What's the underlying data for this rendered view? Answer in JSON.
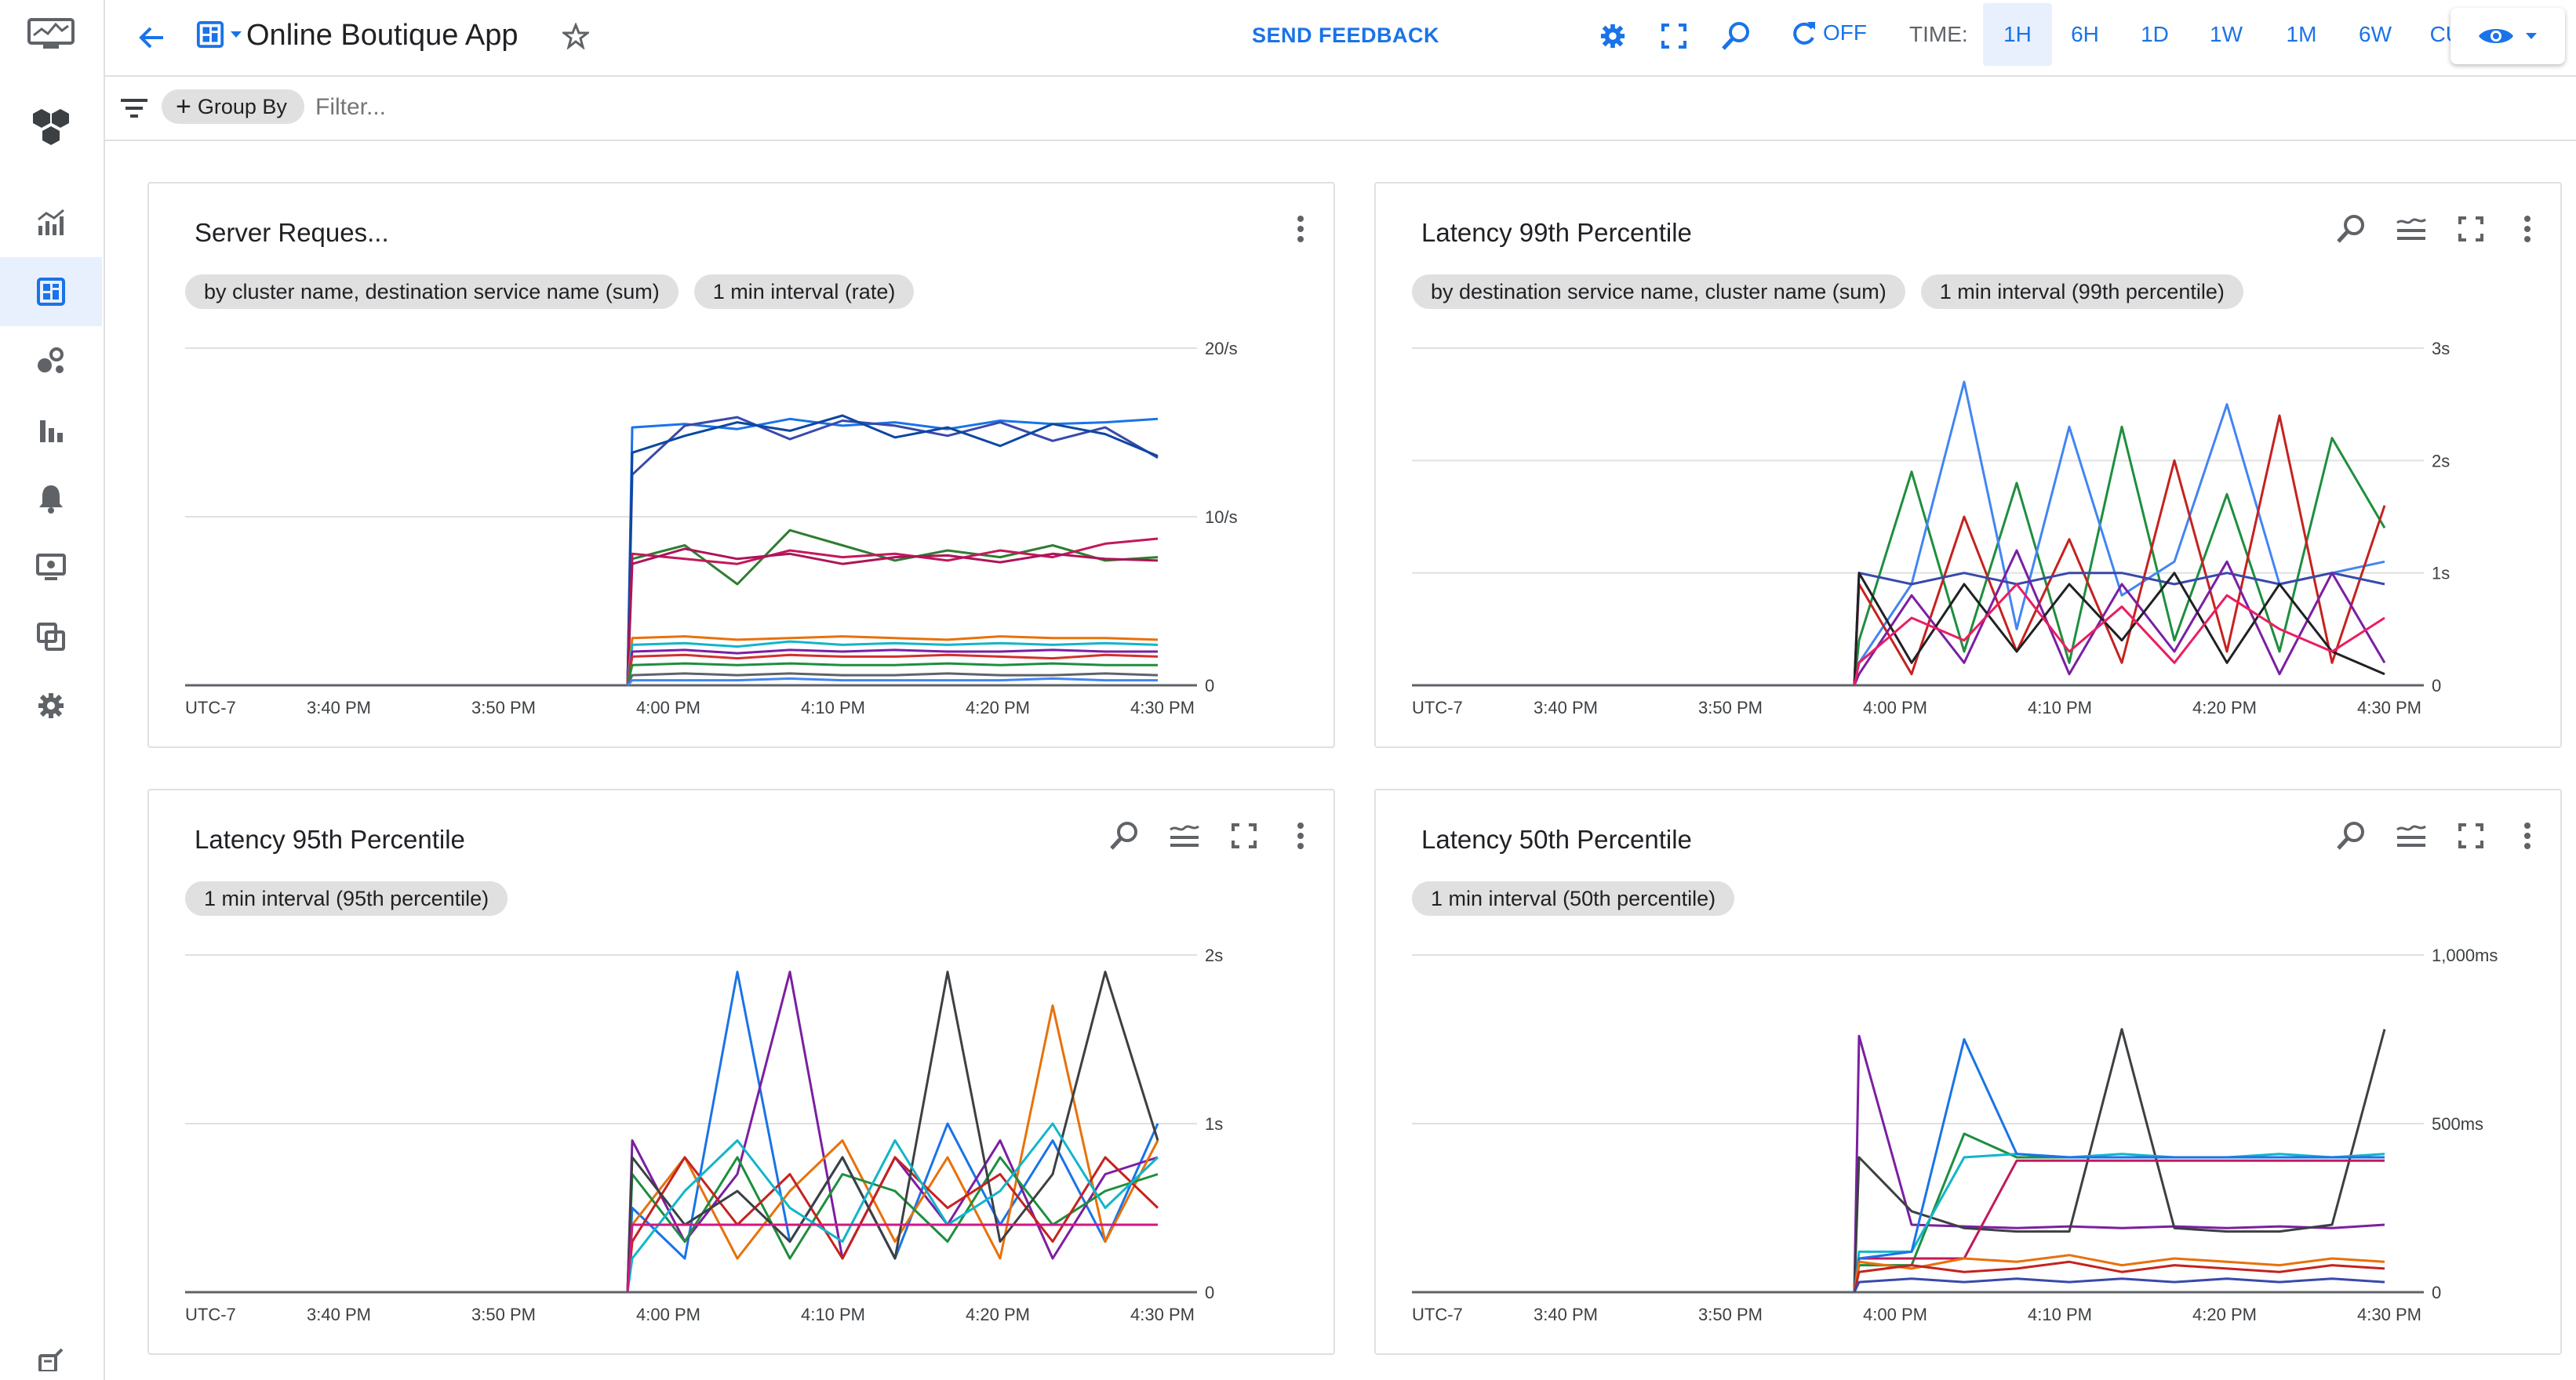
{
  "app": {
    "title": "Online Boutique App",
    "send_feedback": "SEND FEEDBACK",
    "auto_refresh": "OFF",
    "time_label": "TIME:",
    "time_options": [
      "1H",
      "6H",
      "1D",
      "1W",
      "1M",
      "6W",
      "CUSTOM"
    ],
    "time_selected": "1H",
    "accent": "#1a73e8"
  },
  "filterbar": {
    "group_by": "Group By",
    "filter_placeholder": "Filter..."
  },
  "sidebar": {
    "icons": [
      "monitoring-logo-icon",
      "hexagons-icon",
      "metrics-explorer-icon",
      "dashboards-icon",
      "services-icon",
      "bar-chart-icon",
      "alert-bell-icon",
      "uptime-monitor-icon",
      "groups-icon",
      "settings-icon",
      "release-notes-icon"
    ],
    "active": "dashboards-icon"
  },
  "panels": [
    {
      "title": "Server Reques...",
      "chips": [
        "by cluster name, destination service name (sum)",
        "1 min interval (rate)"
      ],
      "show_actions": false
    },
    {
      "title": "Latency 99th Percentile",
      "chips": [
        "by destination service name, cluster name (sum)",
        "1 min interval (99th percentile)"
      ],
      "show_actions": true
    },
    {
      "title": "Latency 95th Percentile",
      "chips": [
        "1 min interval (95th percentile)"
      ],
      "show_actions": true
    },
    {
      "title": "Latency 50th Percentile",
      "chips": [
        "1 min interval (50th percentile)"
      ],
      "show_actions": true
    }
  ],
  "chart_data": [
    {
      "type": "line",
      "title": "Server Reques...",
      "x_ticks": [
        "UTC-7",
        "3:40 PM",
        "3:50 PM",
        "4:00 PM",
        "4:10 PM",
        "4:20 PM",
        "4:30 PM"
      ],
      "y_ticks": [
        "0",
        "10/s",
        "20/s"
      ],
      "ylim": [
        0,
        20
      ],
      "grid": true,
      "series": [
        {
          "color": "#1a73e8",
          "values": [
            0,
            15.3,
            15.5,
            15.2,
            15.8,
            15.4,
            15.6,
            15.2,
            15.7,
            15.5,
            15.6,
            15.8
          ]
        },
        {
          "color": "#3949ab",
          "values": [
            0,
            12.5,
            15.4,
            15.9,
            14.6,
            15.7,
            15.4,
            14.8,
            15.6,
            14.5,
            15.3,
            13.5
          ]
        },
        {
          "color": "#0d47a1",
          "values": [
            0,
            13.8,
            14.8,
            15.6,
            15.1,
            16.0,
            14.7,
            15.3,
            14.2,
            15.5,
            14.9,
            13.6
          ]
        },
        {
          "color": "#2e7d32",
          "values": [
            0,
            7.5,
            8.3,
            6.0,
            9.2,
            8.3,
            7.4,
            8.0,
            7.6,
            8.3,
            7.4,
            7.6
          ]
        },
        {
          "color": "#c2185b",
          "values": [
            0,
            7.8,
            7.5,
            7.2,
            8.0,
            7.6,
            7.8,
            7.4,
            8.0,
            7.6,
            8.4,
            8.7
          ]
        },
        {
          "color": "#ad1457",
          "values": [
            0,
            7.2,
            8.1,
            7.5,
            7.8,
            7.2,
            7.6,
            7.7,
            7.3,
            7.8,
            7.5,
            7.4
          ]
        },
        {
          "color": "#e8710a",
          "values": [
            0,
            2.8,
            2.9,
            2.7,
            2.8,
            2.9,
            2.8,
            2.7,
            2.9,
            2.8,
            2.8,
            2.7
          ]
        },
        {
          "color": "#12b5cb",
          "values": [
            0,
            2.4,
            2.5,
            2.3,
            2.6,
            2.4,
            2.5,
            2.4,
            2.5,
            2.4,
            2.5,
            2.4
          ]
        },
        {
          "color": "#7b1fa2",
          "values": [
            0,
            2.0,
            2.1,
            1.9,
            2.1,
            2.0,
            2.1,
            2.0,
            2.0,
            2.1,
            2.0,
            2.0
          ]
        },
        {
          "color": "#d32f2f",
          "values": [
            0,
            1.7,
            1.8,
            1.6,
            1.8,
            1.7,
            1.7,
            1.8,
            1.7,
            1.6,
            1.8,
            1.7
          ]
        },
        {
          "color": "#1e8e3e",
          "values": [
            0,
            1.2,
            1.3,
            1.2,
            1.3,
            1.2,
            1.2,
            1.3,
            1.2,
            1.3,
            1.2,
            1.2
          ]
        },
        {
          "color": "#5f6368",
          "values": [
            0,
            0.6,
            0.7,
            0.6,
            0.7,
            0.6,
            0.6,
            0.7,
            0.6,
            0.6,
            0.7,
            0.6
          ]
        },
        {
          "color": "#4285f4",
          "values": [
            0,
            0.3,
            0.3,
            0.3,
            0.4,
            0.3,
            0.3,
            0.3,
            0.3,
            0.4,
            0.3,
            0.3
          ]
        }
      ]
    },
    {
      "type": "line",
      "title": "Latency 99th Percentile",
      "x_ticks": [
        "UTC-7",
        "3:40 PM",
        "3:50 PM",
        "4:00 PM",
        "4:10 PM",
        "4:20 PM",
        "4:30 PM"
      ],
      "y_ticks": [
        "0",
        "1s",
        "2s",
        "3s"
      ],
      "ylim": [
        0,
        3
      ],
      "grid": true,
      "series": [
        {
          "color": "#1e8e3e",
          "values": [
            0,
            0.4,
            1.9,
            0.3,
            1.8,
            0.2,
            2.3,
            0.4,
            1.7,
            0.3,
            2.2,
            1.4
          ]
        },
        {
          "color": "#4285f4",
          "values": [
            0,
            0.2,
            0.9,
            2.7,
            0.5,
            2.3,
            0.8,
            1.1,
            2.5,
            0.9,
            1.0,
            1.1
          ]
        },
        {
          "color": "#c5221f",
          "values": [
            0,
            0.9,
            0.1,
            1.5,
            0.3,
            1.3,
            0.2,
            2.0,
            0.3,
            2.4,
            0.2,
            1.6
          ]
        },
        {
          "color": "#3949ab",
          "values": [
            0,
            1.0,
            0.9,
            1.0,
            0.9,
            1.0,
            1.0,
            0.9,
            1.0,
            0.9,
            1.0,
            0.9
          ]
        },
        {
          "color": "#7b1fa2",
          "values": [
            0,
            0.1,
            0.8,
            0.2,
            1.2,
            0.1,
            0.9,
            0.3,
            1.1,
            0.1,
            1.0,
            0.2
          ]
        },
        {
          "color": "#202124",
          "values": [
            0,
            1.0,
            0.2,
            0.9,
            0.3,
            0.9,
            0.4,
            1.0,
            0.2,
            0.9,
            0.3,
            0.1
          ]
        },
        {
          "color": "#e91e63",
          "values": [
            0,
            0.2,
            0.6,
            0.4,
            0.9,
            0.3,
            0.7,
            0.2,
            0.8,
            0.5,
            0.3,
            0.6
          ]
        }
      ]
    },
    {
      "type": "line",
      "title": "Latency 95th Percentile",
      "x_ticks": [
        "UTC-7",
        "3:40 PM",
        "3:50 PM",
        "4:00 PM",
        "4:10 PM",
        "4:20 PM",
        "4:30 PM"
      ],
      "y_ticks": [
        "0",
        "1s",
        "2s"
      ],
      "ylim": [
        0,
        2
      ],
      "grid": true,
      "series": [
        {
          "color": "#1a73e8",
          "values": [
            0,
            0.5,
            0.2,
            1.9,
            0.3,
            0.8,
            0.2,
            1.0,
            0.4,
            0.9,
            0.3,
            1.0
          ]
        },
        {
          "color": "#7b1fa2",
          "values": [
            0,
            0.9,
            0.3,
            0.7,
            1.9,
            0.2,
            0.8,
            0.4,
            0.9,
            0.2,
            0.7,
            0.8
          ]
        },
        {
          "color": "#e8710a",
          "values": [
            0,
            0.4,
            0.8,
            0.2,
            0.6,
            0.9,
            0.3,
            0.8,
            0.2,
            1.7,
            0.3,
            0.9
          ]
        },
        {
          "color": "#1e8e3e",
          "values": [
            0,
            0.7,
            0.3,
            0.8,
            0.2,
            0.7,
            0.6,
            0.3,
            0.8,
            0.4,
            0.6,
            0.7
          ]
        },
        {
          "color": "#c5221f",
          "values": [
            0,
            0.3,
            0.8,
            0.4,
            0.7,
            0.2,
            0.8,
            0.5,
            0.7,
            0.3,
            0.8,
            0.5
          ]
        },
        {
          "color": "#3c4043",
          "values": [
            0,
            0.8,
            0.4,
            0.6,
            0.3,
            0.8,
            0.2,
            1.9,
            0.3,
            0.7,
            1.9,
            0.9
          ]
        },
        {
          "color": "#12b5cb",
          "values": [
            0,
            0.2,
            0.6,
            0.9,
            0.5,
            0.3,
            0.9,
            0.4,
            0.6,
            1.0,
            0.5,
            0.8
          ]
        },
        {
          "color": "#d01884",
          "values": [
            0,
            0.4,
            0.4,
            0.4,
            0.4,
            0.4,
            0.4,
            0.4,
            0.4,
            0.4,
            0.4,
            0.4
          ]
        }
      ]
    },
    {
      "type": "line",
      "title": "Latency 50th Percentile",
      "x_ticks": [
        "UTC-7",
        "3:40 PM",
        "3:50 PM",
        "4:00 PM",
        "4:10 PM",
        "4:20 PM",
        "4:30 PM"
      ],
      "y_ticks": [
        "0",
        "500ms",
        "1,000ms"
      ],
      "ylim": [
        0,
        1000
      ],
      "grid": true,
      "series": [
        {
          "color": "#7b1fa2",
          "values": [
            0,
            760,
            200,
            195,
            190,
            195,
            190,
            195,
            190,
            195,
            190,
            200
          ]
        },
        {
          "color": "#3c4043",
          "values": [
            0,
            400,
            240,
            190,
            180,
            180,
            780,
            190,
            180,
            180,
            200,
            780
          ]
        },
        {
          "color": "#1e8e3e",
          "values": [
            0,
            80,
            80,
            470,
            400,
            400,
            400,
            400,
            400,
            400,
            400,
            400
          ]
        },
        {
          "color": "#12b5cb",
          "values": [
            0,
            120,
            120,
            400,
            410,
            400,
            410,
            400,
            400,
            410,
            400,
            410
          ]
        },
        {
          "color": "#c2185b",
          "values": [
            0,
            100,
            100,
            100,
            390,
            390,
            390,
            390,
            390,
            390,
            390,
            390
          ]
        },
        {
          "color": "#1a73e8",
          "values": [
            0,
            100,
            120,
            750,
            410,
            400,
            400,
            400,
            400,
            400,
            400,
            400
          ]
        },
        {
          "color": "#e8710a",
          "values": [
            0,
            90,
            70,
            100,
            90,
            110,
            80,
            100,
            90,
            80,
            100,
            90
          ]
        },
        {
          "color": "#c5221f",
          "values": [
            0,
            60,
            80,
            60,
            70,
            90,
            60,
            80,
            70,
            60,
            80,
            70
          ]
        },
        {
          "color": "#3949ab",
          "values": [
            0,
            30,
            40,
            30,
            40,
            30,
            40,
            30,
            40,
            30,
            40,
            30
          ]
        }
      ]
    }
  ]
}
